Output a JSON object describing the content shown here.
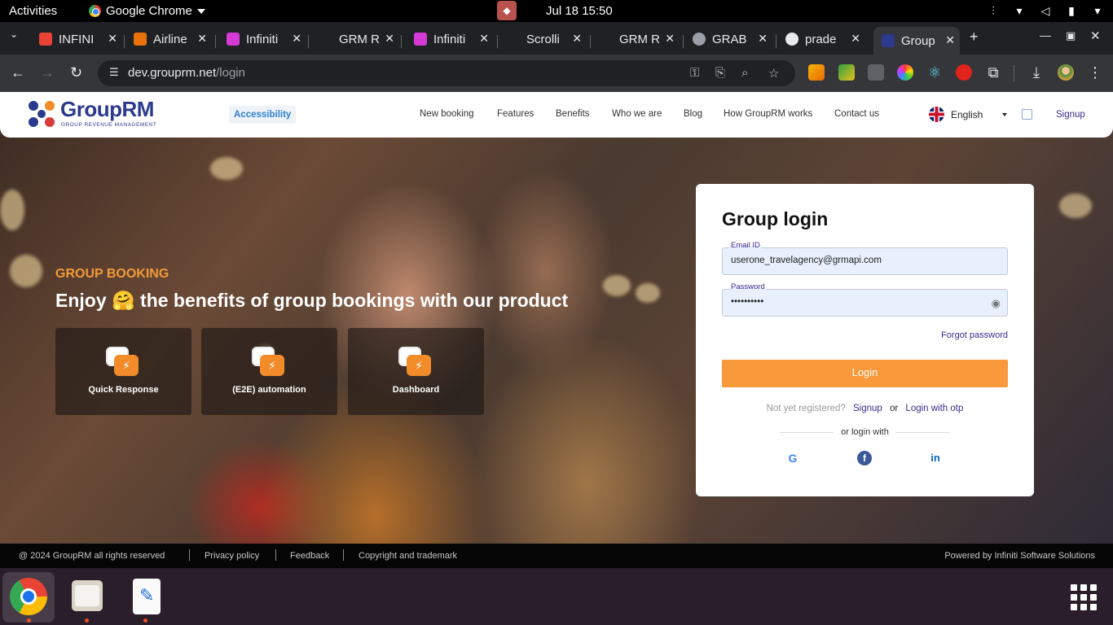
{
  "system": {
    "activities": "Activities",
    "app_name": "Google Chrome",
    "clock": "Jul 18  15:50"
  },
  "browser": {
    "tabs": [
      {
        "title": "INFINI",
        "favicon_color": "#ea4335"
      },
      {
        "title": "Airline",
        "favicon_color": "#e8710a"
      },
      {
        "title": "Infiniti",
        "favicon_color": "#d63ad6"
      },
      {
        "title": "GRM R",
        "favicon_color": "#202124"
      },
      {
        "title": "Infiniti",
        "favicon_color": "#d63ad6"
      },
      {
        "title": "Scrolli",
        "favicon_color": "#202124"
      },
      {
        "title": "GRM R",
        "favicon_color": "#202124"
      },
      {
        "title": "GRAB",
        "favicon_color": "#9aa0a6"
      },
      {
        "title": "prade",
        "favicon_color": "#e8eaed"
      },
      {
        "title": "Group",
        "favicon_color": "#2b3a8c",
        "active": true
      }
    ],
    "url_host": "dev.grouprm.net",
    "url_path": "/login"
  },
  "site": {
    "logo_title": "GroupRM",
    "logo_subtitle": "GROUP REVENUE MANAGEMENT",
    "accessibility_label": "Accessibility",
    "nav": [
      {
        "label": "New booking"
      },
      {
        "label": "Features"
      },
      {
        "label": "Benefits"
      },
      {
        "label": "Who we are"
      },
      {
        "label": "Blog"
      },
      {
        "label": "How GroupRM works"
      },
      {
        "label": "Contact us"
      }
    ],
    "language": "English",
    "signup": "Signup"
  },
  "hero": {
    "eyebrow": "GROUP BOOKING",
    "headline": "Enjoy 🤗 the benefits of group bookings with our product",
    "features": [
      {
        "label": "Quick Response"
      },
      {
        "label": "(E2E) automation"
      },
      {
        "label": "Dashboard"
      }
    ]
  },
  "login": {
    "title": "Group login",
    "email_label": "Email ID",
    "email_value": "userone_travelagency@grmapi.com",
    "password_label": "Password",
    "password_value": "••••••••••",
    "forgot": "Forgot password",
    "button": "Login",
    "not_registered": "Not yet registered?",
    "signup_link": "Signup",
    "or": "or",
    "otp_link": "Login with otp",
    "or_login_with": "or login with",
    "social": [
      "google-icon",
      "facebook-icon",
      "linkedin-icon"
    ]
  },
  "footer": {
    "copyright": "@ 2024  GroupRM  all rights reserved",
    "privacy": "Privacy policy",
    "feedback": "Feedback",
    "copyright_trademark": "Copyright and trademark",
    "powered_by": "Powered by Infiniti Software Solutions"
  },
  "colors": {
    "accent_orange": "#f8993b",
    "brand_blue": "#2b3a8c",
    "link_purple": "#3b2a8c"
  }
}
